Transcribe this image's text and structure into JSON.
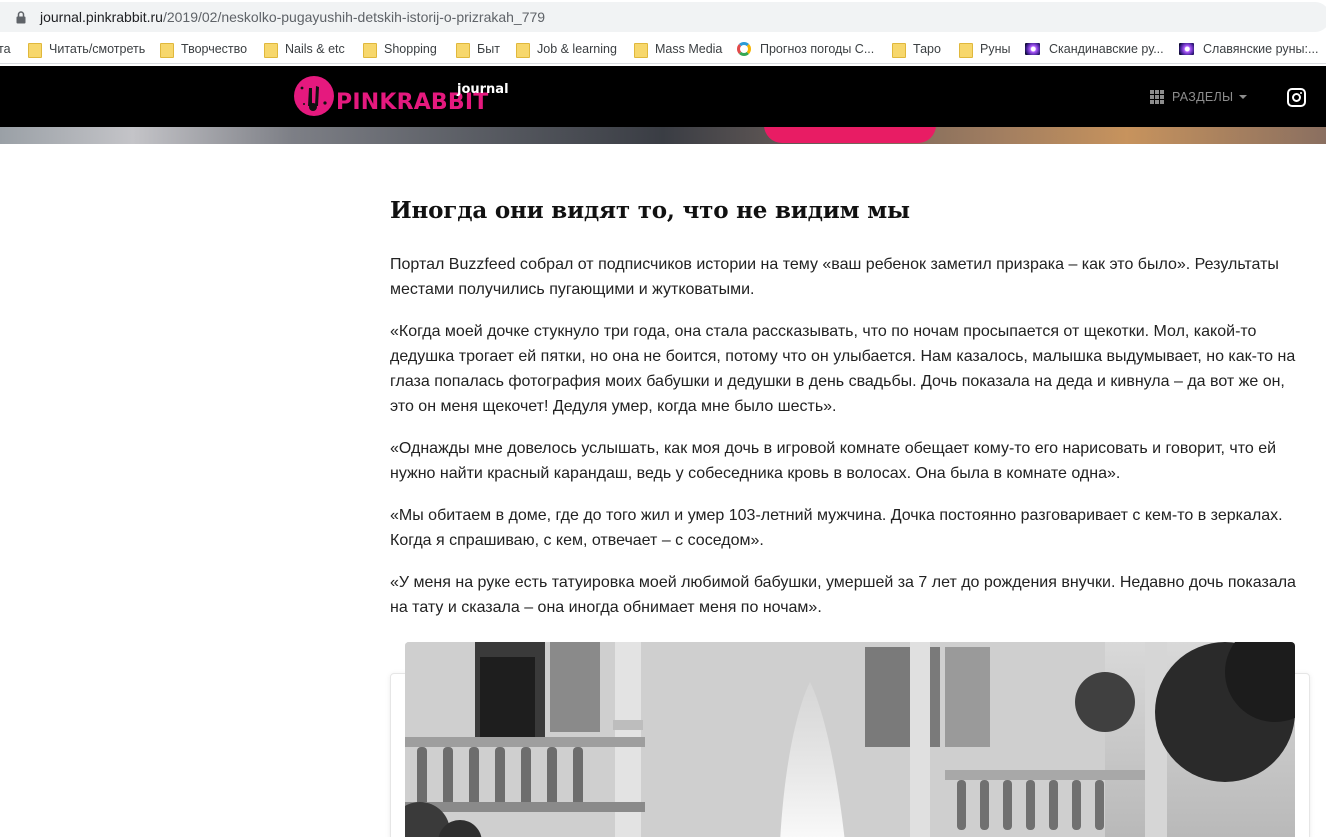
{
  "browser": {
    "url_host": "journal.pinkrabbit.ru",
    "url_path": "/2019/02/neskolko-pugayushih-detskih-istorij-o-prizrakah_779"
  },
  "bookmarks": [
    {
      "label": "та",
      "icon": "none"
    },
    {
      "label": "Читать/смотреть",
      "icon": "folder-icon"
    },
    {
      "label": "Творчество",
      "icon": "folder-icon"
    },
    {
      "label": "Nails & etc",
      "icon": "folder-icon"
    },
    {
      "label": "Shopping",
      "icon": "folder-icon"
    },
    {
      "label": "Быт",
      "icon": "folder-icon"
    },
    {
      "label": "Job & learning",
      "icon": "folder-icon"
    },
    {
      "label": "Mass Media",
      "icon": "folder-icon"
    },
    {
      "label": "Прогноз погоды С...",
      "icon": "weather-ring-icon"
    },
    {
      "label": "Таро",
      "icon": "folder-icon"
    },
    {
      "label": "Руны",
      "icon": "folder-icon"
    },
    {
      "label": "Скандинавские ру...",
      "icon": "galaxy-icon"
    },
    {
      "label": "Славянские руны:...",
      "icon": "galaxy-icon"
    }
  ],
  "site": {
    "logo_word": "PINKRABBIT",
    "logo_journal": "journal",
    "sections_label": "РАЗДЕЛЫ"
  },
  "article": {
    "heading": "Иногда они видят то, что не видим мы",
    "paragraphs": [
      "Портал Buzzfeed собрал от подписчиков истории на тему «ваш ребенок заметил призрака – как это было». Результаты местами получились пугающими и жутковатыми.",
      "«Когда моей дочке стукнуло три года, она стала рассказывать, что по ночам просыпается от щекотки. Мол, какой-то дедушка трогает ей пятки, но она не боится, потому что он улыбается. Нам казалось, малышка выдумывает, но как-то на глаза попалась фотография моих бабушки и дедушки в день свадьбы. Дочь показала на деда и кивнула – да вот же он, это он меня щекочет! Дедуля умер, когда мне было шесть».",
      "«Однажды мне довелось услышать, как моя дочь в игровой комнате обещает кому-то его нарисовать и говорит, что ей нужно найти красный карандаш, ведь у собеседника кровь в волосах. Она была в комнате одна».",
      "«Мы обитаем в доме, где до того жил и умер 103-летний мужчина. Дочка постоянно разговаривает с кем-то в зеркалах. Когда я спрашиваю, с кем, отвечает – с соседом».",
      "«У меня на руке есть татуировка моей любимой бабушки, умершей за 7 лет до рождения внучки. Недавно дочь показала на тату и сказала – она иногда обнимает меня по ночам»."
    ]
  },
  "colors": {
    "brand_pink": "#e5197e",
    "header_bg": "#000000",
    "hero_button": "#e81c64"
  }
}
